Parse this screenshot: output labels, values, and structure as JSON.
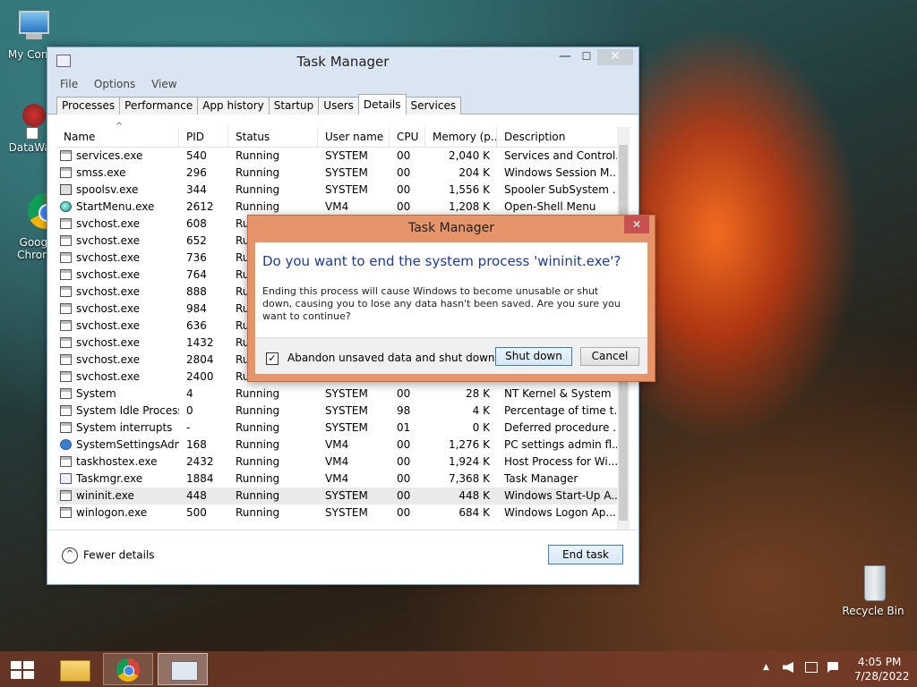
{
  "desktop": {
    "icons": [
      {
        "label": "My Comp"
      },
      {
        "label": "DataWag"
      },
      {
        "label": "Googl Chrom"
      },
      {
        "label": "Recycle Bin"
      }
    ]
  },
  "task_manager": {
    "title": "Task Manager",
    "window_buttons": {
      "minimize": "—",
      "maximize": "☐",
      "close": "✕"
    },
    "menu": [
      "File",
      "Options",
      "View"
    ],
    "tabs": [
      "Processes",
      "Performance",
      "App history",
      "Startup",
      "Users",
      "Details",
      "Services"
    ],
    "active_tab": "Details",
    "sort_indicator": "^",
    "columns": [
      "Name",
      "PID",
      "Status",
      "User name",
      "CPU",
      "Memory (p...",
      "Description"
    ],
    "rows": [
      {
        "name": "services.exe",
        "pid": "540",
        "status": "Running",
        "user": "SYSTEM",
        "cpu": "00",
        "mem": "2,040 K",
        "desc": "Services and Control...",
        "icon": "window-icon"
      },
      {
        "name": "smss.exe",
        "pid": "296",
        "status": "Running",
        "user": "SYSTEM",
        "cpu": "00",
        "mem": "204 K",
        "desc": "Windows Session M...",
        "icon": "window-icon"
      },
      {
        "name": "spoolsv.exe",
        "pid": "344",
        "status": "Running",
        "user": "SYSTEM",
        "cpu": "00",
        "mem": "1,556 K",
        "desc": "Spooler SubSystem ...",
        "icon": "printer-icon"
      },
      {
        "name": "StartMenu.exe",
        "pid": "2612",
        "status": "Running",
        "user": "VM4",
        "cpu": "00",
        "mem": "1,208 K",
        "desc": "Open-Shell Menu",
        "icon": "globe-icon"
      },
      {
        "name": "svchost.exe",
        "pid": "608",
        "status": "Ru",
        "user": "",
        "cpu": "",
        "mem": "",
        "desc": "",
        "icon": "window-icon"
      },
      {
        "name": "svchost.exe",
        "pid": "652",
        "status": "Ru",
        "user": "",
        "cpu": "",
        "mem": "",
        "desc": "",
        "icon": "window-icon"
      },
      {
        "name": "svchost.exe",
        "pid": "736",
        "status": "Ru",
        "user": "",
        "cpu": "",
        "mem": "",
        "desc": "",
        "icon": "window-icon"
      },
      {
        "name": "svchost.exe",
        "pid": "764",
        "status": "Ru",
        "user": "",
        "cpu": "",
        "mem": "",
        "desc": "",
        "icon": "window-icon"
      },
      {
        "name": "svchost.exe",
        "pid": "888",
        "status": "Ru",
        "user": "",
        "cpu": "",
        "mem": "",
        "desc": "",
        "icon": "window-icon"
      },
      {
        "name": "svchost.exe",
        "pid": "984",
        "status": "Ru",
        "user": "",
        "cpu": "",
        "mem": "",
        "desc": "",
        "icon": "window-icon"
      },
      {
        "name": "svchost.exe",
        "pid": "636",
        "status": "Ru",
        "user": "",
        "cpu": "",
        "mem": "",
        "desc": "",
        "icon": "window-icon"
      },
      {
        "name": "svchost.exe",
        "pid": "1432",
        "status": "Ru",
        "user": "",
        "cpu": "",
        "mem": "",
        "desc": "",
        "icon": "window-icon"
      },
      {
        "name": "svchost.exe",
        "pid": "2804",
        "status": "Ru",
        "user": "",
        "cpu": "",
        "mem": "",
        "desc": "",
        "icon": "window-icon"
      },
      {
        "name": "svchost.exe",
        "pid": "2400",
        "status": "Ru",
        "user": "",
        "cpu": "",
        "mem": "",
        "desc": "",
        "icon": "window-icon"
      },
      {
        "name": "System",
        "pid": "4",
        "status": "Running",
        "user": "SYSTEM",
        "cpu": "00",
        "mem": "28 K",
        "desc": "NT Kernel & System",
        "icon": "window-icon"
      },
      {
        "name": "System Idle Process",
        "pid": "0",
        "status": "Running",
        "user": "SYSTEM",
        "cpu": "98",
        "mem": "4 K",
        "desc": "Percentage of time t...",
        "icon": "window-icon"
      },
      {
        "name": "System interrupts",
        "pid": "-",
        "status": "Running",
        "user": "SYSTEM",
        "cpu": "01",
        "mem": "0 K",
        "desc": "Deferred procedure ...",
        "icon": "window-icon"
      },
      {
        "name": "SystemSettingsAdmi...",
        "pid": "168",
        "status": "Running",
        "user": "VM4",
        "cpu": "00",
        "mem": "1,276 K",
        "desc": "PC settings admin fl...",
        "icon": "gear-icon"
      },
      {
        "name": "taskhostex.exe",
        "pid": "2432",
        "status": "Running",
        "user": "VM4",
        "cpu": "00",
        "mem": "1,924 K",
        "desc": "Host Process for Wi...",
        "icon": "window-icon"
      },
      {
        "name": "Taskmgr.exe",
        "pid": "1884",
        "status": "Running",
        "user": "VM4",
        "cpu": "00",
        "mem": "7,368 K",
        "desc": "Task Manager",
        "icon": "chart-icon"
      },
      {
        "name": "wininit.exe",
        "pid": "448",
        "status": "Running",
        "user": "SYSTEM",
        "cpu": "00",
        "mem": "448 K",
        "desc": "Windows Start-Up A...",
        "icon": "window-icon",
        "selected": true
      },
      {
        "name": "winlogon.exe",
        "pid": "500",
        "status": "Running",
        "user": "SYSTEM",
        "cpu": "00",
        "mem": "684 K",
        "desc": "Windows Logon Ap...",
        "icon": "window-icon"
      }
    ],
    "fewer_details": "Fewer details",
    "fewer_glyph": "^",
    "end_task": "End task"
  },
  "dialog": {
    "title": "Task Manager",
    "close_glyph": "✕",
    "question": "Do you want to end the system process 'wininit.exe'?",
    "explanation": "Ending this process will cause Windows to become unusable or shut down, causing you to lose any data hasn't been saved. Are you sure you want to continue?",
    "checkbox_mark": "✓",
    "checkbox_label": "Abandon unsaved data and shut down.",
    "checkbox_checked": true,
    "shutdown_button": "Shut down",
    "cancel_button": "Cancel"
  },
  "taskbar": {
    "tray": {
      "arrow": "▲",
      "time": "4:05 PM",
      "date": "7/28/2022"
    },
    "colors": {
      "accent": "#3c7fb1",
      "dialog_frame": "#e6956b"
    }
  }
}
